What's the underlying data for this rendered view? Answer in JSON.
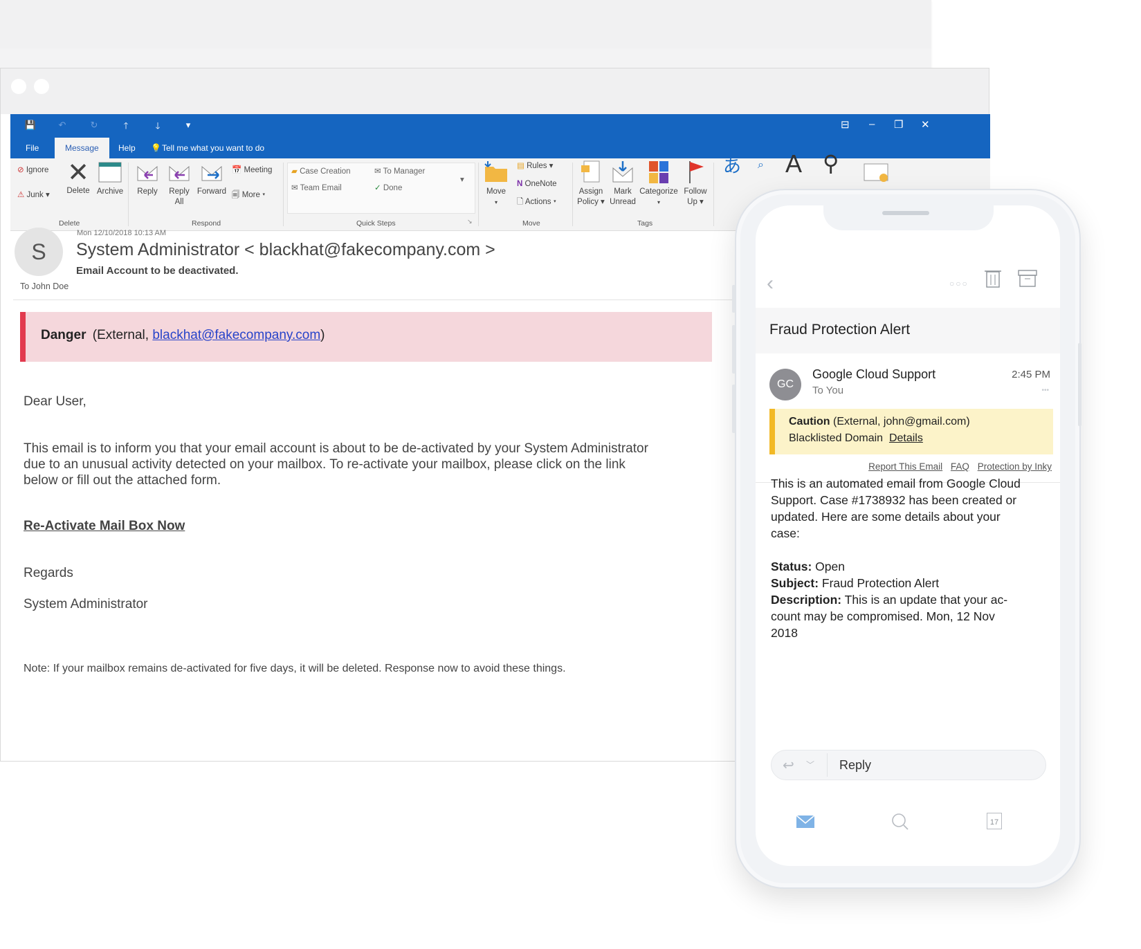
{
  "outlook": {
    "quick_access": [
      "💾",
      "↶",
      "↻",
      "🡑",
      "🡓",
      "▾"
    ],
    "tabs": {
      "file": "File",
      "message": "Message",
      "help": "Help",
      "tell_me": "Tell me what you want to do"
    },
    "ribbon": {
      "delete_group": {
        "ignore": "Ignore",
        "junk": "Junk",
        "delete": "Delete",
        "archive": "Archive",
        "label": "Delete"
      },
      "respond_group": {
        "reply": "Reply",
        "reply_all_1": "Reply",
        "reply_all_2": "All",
        "forward": "Forward",
        "meeting": "Meeting",
        "more": "More",
        "label": "Respond"
      },
      "quick_steps": {
        "case_creation": "Case Creation",
        "to_manager": "To Manager",
        "team_email": "Team Email",
        "done": "Done",
        "label": "Quick Steps"
      },
      "move_group": {
        "move": "Move",
        "rules": "Rules",
        "onenote": "OneNote",
        "actions": "Actions",
        "label": "Move"
      },
      "tags_group": {
        "assign_1": "Assign",
        "assign_2": "Policy",
        "mark_1": "Mark",
        "mark_2": "Unread",
        "categorize": "Categorize",
        "follow_1": "Follow",
        "follow_2": "Up",
        "label": "Tags"
      }
    },
    "email": {
      "avatar_initial": "S",
      "date": "Mon 12/10/2018 10:13 AM",
      "from": "System Administrator  < blackhat@fakecompany.com >",
      "subject": "Email Account to be deactivated.",
      "to": "To   John Doe",
      "banner": {
        "label": "Danger",
        "pre": "(External, ",
        "link": "blackhat@fakecompany.com",
        "post": ")"
      },
      "greeting": "Dear User,",
      "paragraph_1": "This email is to inform you that your email account is about to be de-activated by your System Administrator",
      "paragraph_2": "due to an unusual activity detected on your mailbox. To re-activate your mailbox, please click on the link",
      "paragraph_3": "below or fill out the attached form.",
      "cta_link": "Re-Activate Mail Box Now",
      "regards": "Regards",
      "signature": "System Administrator",
      "note": "Note: If your mailbox remains de-activated for five days, it will be deleted. Response now to avoid these things."
    }
  },
  "phone": {
    "title": "Fraud Protection Alert",
    "sender_initials": "GC",
    "sender": "Google Cloud Support",
    "recipient": "To You",
    "time": "2:45 PM",
    "caution": {
      "label": "Caution",
      "detail": "(External, john@gmail.com)",
      "line2": "Blacklisted Domain",
      "details_link": "Details"
    },
    "links": [
      "Report This Email",
      "FAQ",
      "Protection by Inky"
    ],
    "body_lines": [
      "This is an automated email from Google Cloud",
      "Support. Case #1738932 has been created or",
      "updated. Here are some details about your",
      "case:"
    ],
    "status": {
      "label": "Status:",
      "value": " Open"
    },
    "subject": {
      "label": "Subject:",
      "value": " Fraud Protection Alert"
    },
    "description": {
      "label": "Description:",
      "value_1": " This is an update that your ac-",
      "value_2": "count may be compromised. Mon, 12 Nov",
      "value_3": "2018"
    },
    "reply_label": "Reply",
    "calendar_day": "17"
  },
  "colors": {
    "outlook_blue": "#1565c0",
    "danger_border": "#e23b4f",
    "danger_bg": "#f5d7dc",
    "caution_border": "#f2b926",
    "caution_bg": "#fcf3c9",
    "link": "#2743c9"
  }
}
